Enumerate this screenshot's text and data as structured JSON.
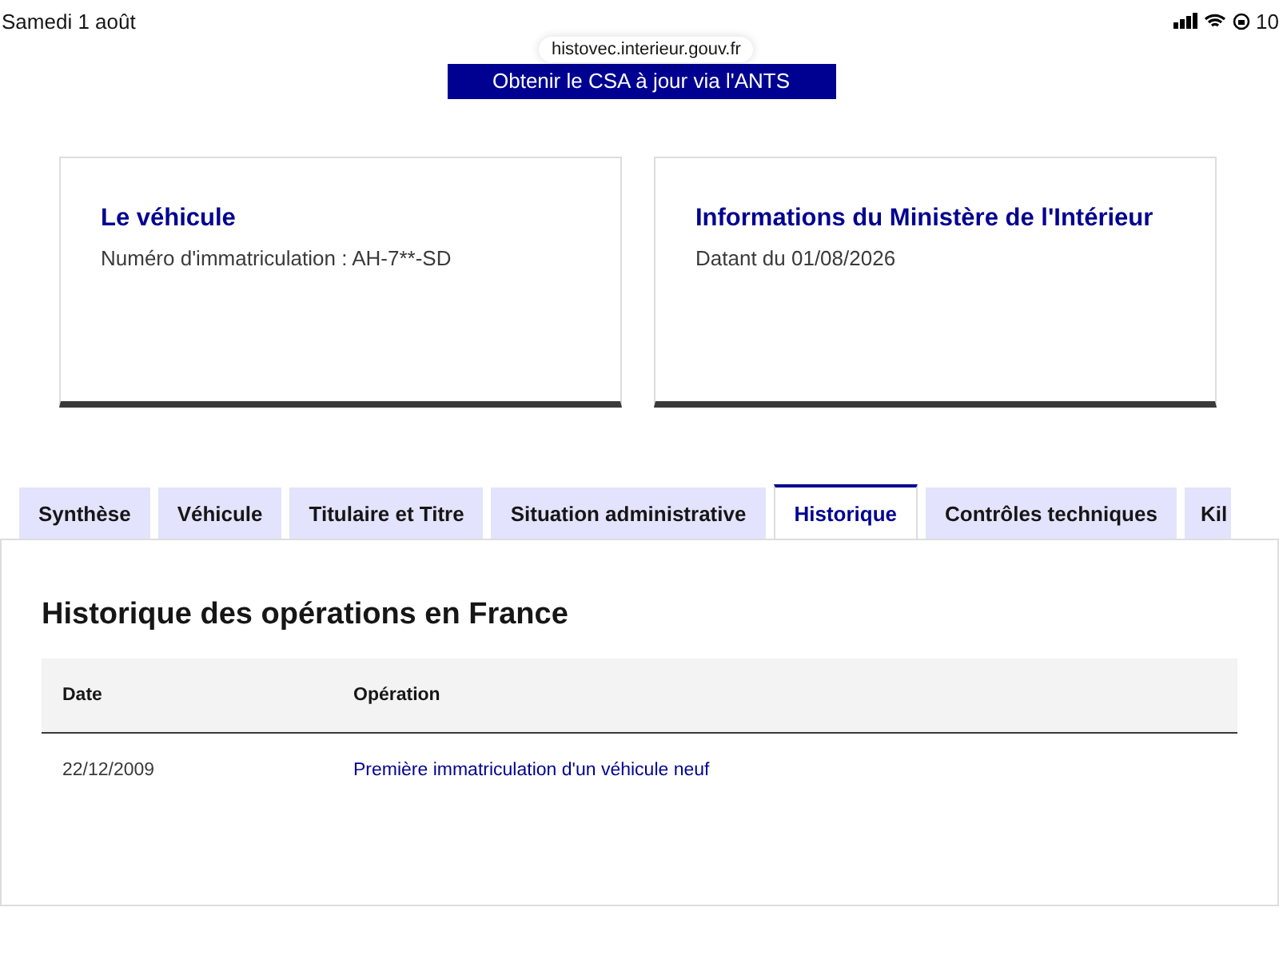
{
  "status_bar": {
    "date": "Samedi 1 août",
    "battery": "10"
  },
  "address_bar": {
    "url": "histovec.interieur.gouv.fr"
  },
  "cta_button": {
    "label": "Obtenir le CSA à jour via l'ANTS"
  },
  "cards": [
    {
      "title": "Le véhicule",
      "lines": [
        "Numéro d'immatriculation : AH-7**-SD"
      ]
    },
    {
      "title": "Informations du Ministère de l'Intérieur",
      "lines": [
        "Datant du 01/08/2026"
      ]
    }
  ],
  "tabs": [
    {
      "label": "Synthèse",
      "selected": false
    },
    {
      "label": "Véhicule",
      "selected": false
    },
    {
      "label": "Titulaire et Titre",
      "selected": false
    },
    {
      "label": "Situation administrative",
      "selected": false
    },
    {
      "label": "Historique",
      "selected": true
    },
    {
      "label": "Contrôles techniques",
      "selected": false
    },
    {
      "label": "Kil",
      "selected": false
    }
  ],
  "panel": {
    "title": "Historique des opérations en France",
    "table": {
      "columns": [
        "Date",
        "Opération"
      ],
      "rows": [
        [
          "22/12/2009",
          "Première immatriculation d'un véhicule neuf"
        ]
      ]
    }
  }
}
